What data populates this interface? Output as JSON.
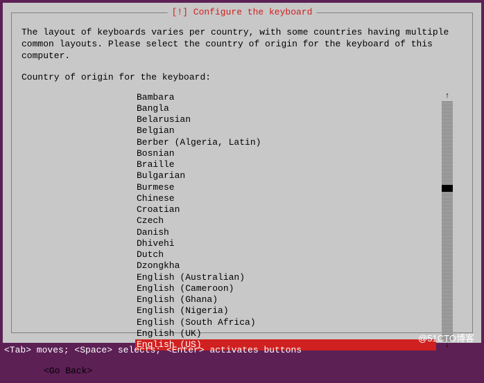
{
  "dialog": {
    "title": "[!] Configure the keyboard",
    "help_text": "The layout of keyboards varies per country, with some countries having multiple common layouts. Please select the country of origin for the keyboard of this computer.",
    "prompt": "Country of origin for the keyboard:",
    "list": [
      "Bambara",
      "Bangla",
      "Belarusian",
      "Belgian",
      "Berber (Algeria, Latin)",
      "Bosnian",
      "Braille",
      "Bulgarian",
      "Burmese",
      "Chinese",
      "Croatian",
      "Czech",
      "Danish",
      "Dhivehi",
      "Dutch",
      "Dzongkha",
      "English (Australian)",
      "English (Cameroon)",
      "English (Ghana)",
      "English (Nigeria)",
      "English (South Africa)",
      "English (UK)",
      "English (US)"
    ],
    "selected_index": 22,
    "go_back": "<Go Back>",
    "scroll_up": "↑",
    "scroll_down": "↓"
  },
  "footer": "<Tab> moves; <Space> selects; <Enter> activates buttons",
  "watermark": "@51CTO博客"
}
